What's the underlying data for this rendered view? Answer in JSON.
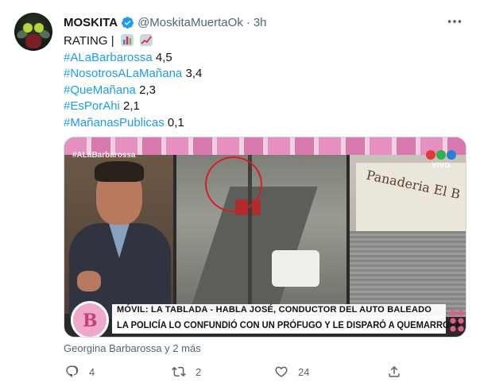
{
  "author": {
    "name": "MOSKITA",
    "handle": "@MoskitaMuertaOk",
    "separator": "·",
    "time": "3h"
  },
  "tweet": {
    "rating_label": "RATING |",
    "lines": [
      {
        "tag": "#ALaBarbarossa",
        "value": "4,5"
      },
      {
        "tag": "#NosotrosALaMañana",
        "value": "3,4"
      },
      {
        "tag": "#QueMañana",
        "value": "2,3"
      },
      {
        "tag": "#EsPorAhi",
        "value": "2,1"
      },
      {
        "tag": "#MañanasPublicas",
        "value": "0,1"
      }
    ]
  },
  "media": {
    "watermark_tag": "#ALaBarbarossa",
    "live_label": "VIVO",
    "live_colors": [
      "#e03a3a",
      "#2bb24c",
      "#2a7fd4"
    ],
    "badge_letter": "B",
    "shop_sign": "Panaderia El B",
    "lower_third_top": "MÓVIL: LA TABLADA - HABLA JOSÉ, CONDUCTOR DEL AUTO BALEADO",
    "lower_third_bottom": "LA POLICÍA LO CONFUNDIÓ CON UN PRÓFUGO Y LE DISPARÓ A QUEMARROPA"
  },
  "tagged": "Georgina Barbarossa y 2 más",
  "actions": {
    "replies": "4",
    "retweets": "2",
    "likes": "24"
  },
  "colors": {
    "accent": "#1d9bf0",
    "muted": "#536471"
  }
}
